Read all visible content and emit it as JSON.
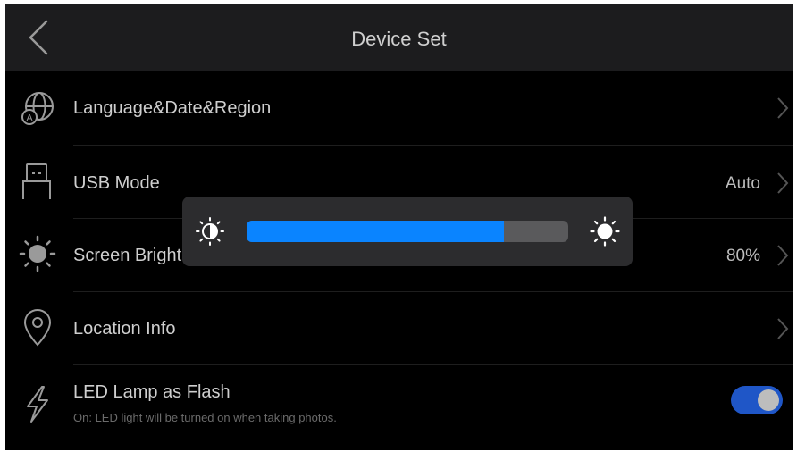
{
  "header": {
    "title": "Device Set"
  },
  "rows": {
    "language": {
      "label": "Language&Date&Region"
    },
    "usb": {
      "label": "USB Mode",
      "value": "Auto"
    },
    "brightness": {
      "label": "Screen Bright",
      "value": "80%"
    },
    "location": {
      "label": "Location Info"
    },
    "led": {
      "label": "LED Lamp as Flash",
      "description": "On: LED light will be turned on when taking photos.",
      "toggle_on": true
    }
  },
  "brightness_popup": {
    "level_percent": 80
  },
  "colors": {
    "accent": "#0a84ff",
    "toggle_on": "#1f56c7",
    "background": "#000000",
    "header": "#1c1c1e",
    "popup": "#2c2c2e"
  },
  "icons": {
    "back": "chevron-left-icon",
    "language": "globe-icon",
    "usb": "usb-icon",
    "brightness": "sun-icon",
    "location": "location-pin-icon",
    "led": "lightning-icon",
    "dim": "sun-dim-icon",
    "bright": "sun-bright-icon"
  }
}
